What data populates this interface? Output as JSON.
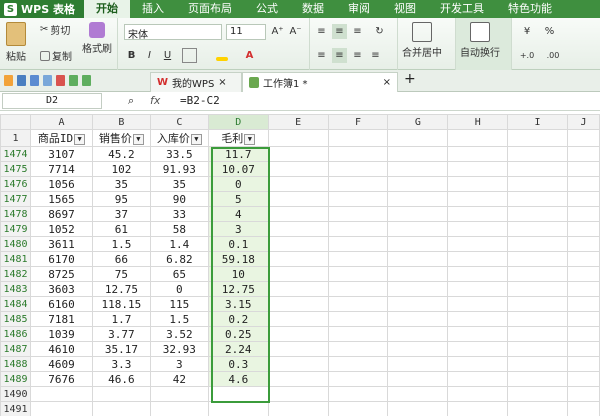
{
  "app": {
    "logo": "WPS 表格",
    "logo_letter": "S"
  },
  "menu": [
    "开始",
    "插入",
    "页面布局",
    "公式",
    "数据",
    "审阅",
    "视图",
    "开发工具",
    "特色功能"
  ],
  "ribbon": {
    "paste": "粘贴",
    "cut": "剪切",
    "copy": "复制",
    "format_painter": "格式刷",
    "font_name": "宋体",
    "font_size": "11",
    "bold": "B",
    "italic": "I",
    "underline": "U",
    "merge_center": "合并居中",
    "wrap_text": "自动换行",
    "percent": "%",
    "increase_font": "A⁺",
    "decrease_font": "A⁻"
  },
  "tabs": {
    "my_wps": "我的WPS",
    "workbook": "工作簿1 *",
    "add": "+"
  },
  "formula_bar": {
    "cell": "D2",
    "fx": "fx",
    "formula": "=B2-C2"
  },
  "columns": [
    "A",
    "B",
    "C",
    "D",
    "E",
    "F",
    "G",
    "H",
    "I",
    "J"
  ],
  "headers": [
    "商品ID",
    "销售价",
    "入库价",
    "毛利"
  ],
  "rows": [
    {
      "n": "1474",
      "a": "3107",
      "b": "45.2",
      "c": "33.5",
      "d": "11.7"
    },
    {
      "n": "1475",
      "a": "7714",
      "b": "102",
      "c": "91.93",
      "d": "10.07"
    },
    {
      "n": "1476",
      "a": "1056",
      "b": "35",
      "c": "35",
      "d": "0"
    },
    {
      "n": "1477",
      "a": "1565",
      "b": "95",
      "c": "90",
      "d": "5"
    },
    {
      "n": "1478",
      "a": "8697",
      "b": "37",
      "c": "33",
      "d": "4"
    },
    {
      "n": "1479",
      "a": "1052",
      "b": "61",
      "c": "58",
      "d": "3"
    },
    {
      "n": "1480",
      "a": "3611",
      "b": "1.5",
      "c": "1.4",
      "d": "0.1"
    },
    {
      "n": "1481",
      "a": "6170",
      "b": "66",
      "c": "6.82",
      "d": "59.18"
    },
    {
      "n": "1482",
      "a": "8725",
      "b": "75",
      "c": "65",
      "d": "10"
    },
    {
      "n": "1483",
      "a": "3603",
      "b": "12.75",
      "c": "0",
      "d": "12.75"
    },
    {
      "n": "1484",
      "a": "6160",
      "b": "118.15",
      "c": "115",
      "d": "3.15"
    },
    {
      "n": "1485",
      "a": "7181",
      "b": "1.7",
      "c": "1.5",
      "d": "0.2"
    },
    {
      "n": "1486",
      "a": "1039",
      "b": "3.77",
      "c": "3.52",
      "d": "0.25"
    },
    {
      "n": "1487",
      "a": "4610",
      "b": "35.17",
      "c": "32.93",
      "d": "2.24"
    },
    {
      "n": "1488",
      "a": "4609",
      "b": "3.3",
      "c": "3",
      "d": "0.3"
    },
    {
      "n": "1489",
      "a": "7676",
      "b": "46.6",
      "c": "42",
      "d": "4.6"
    }
  ],
  "empty_rows": [
    "1490",
    "1491"
  ],
  "header_row_num": "1",
  "colors": {
    "accent": "#3f8f3f",
    "selection": "#3b9c3b"
  }
}
